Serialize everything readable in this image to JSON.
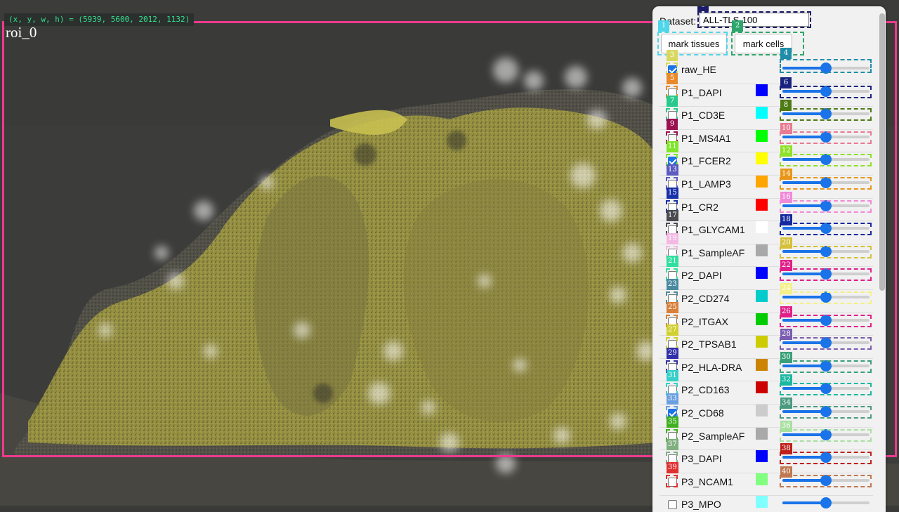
{
  "viewer": {
    "coord_readout": "(x, y, w, h) = (5939, 5600, 2012, 1132)",
    "roi_label": "roi_0",
    "roi_color": "#ee3a8f"
  },
  "panel": {
    "dataset_label": "Dataset:",
    "dataset_value": "ALL-TLS-100",
    "mark_tissues_label": "mark tissues",
    "mark_cells_label": "mark cells"
  },
  "tags": [
    {
      "n": "0",
      "color": "#1c1c6b"
    },
    {
      "n": "1",
      "color": "#4fd6e8"
    },
    {
      "n": "2",
      "color": "#2da66b"
    },
    {
      "n": "3",
      "color": "#d8d860"
    },
    {
      "n": "4",
      "color": "#1f8da8"
    },
    {
      "n": "5",
      "color": "#e88a2a"
    },
    {
      "n": "6",
      "color": "#1a237e"
    },
    {
      "n": "7",
      "color": "#28c98c"
    },
    {
      "n": "8",
      "color": "#4e7a16"
    },
    {
      "n": "9",
      "color": "#9c1150"
    },
    {
      "n": "10",
      "color": "#e87a92"
    },
    {
      "n": "11",
      "color": "#7fe62a"
    },
    {
      "n": "12",
      "color": "#8ee028"
    },
    {
      "n": "13",
      "color": "#5a5cc0"
    },
    {
      "n": "14",
      "color": "#e8961a"
    },
    {
      "n": "15",
      "color": "#1830a8"
    },
    {
      "n": "16",
      "color": "#f08ad8"
    },
    {
      "n": "17",
      "color": "#4a4a50"
    },
    {
      "n": "18",
      "color": "#142a9e"
    },
    {
      "n": "19",
      "color": "#f3b9e3"
    },
    {
      "n": "20",
      "color": "#d4c03a"
    },
    {
      "n": "21",
      "color": "#2ee0a0"
    },
    {
      "n": "22",
      "color": "#e0208a"
    },
    {
      "n": "23",
      "color": "#4a8aa0"
    },
    {
      "n": "24",
      "color": "#f5f088"
    },
    {
      "n": "25",
      "color": "#d8803a"
    },
    {
      "n": "26",
      "color": "#e0208a"
    },
    {
      "n": "27",
      "color": "#d0d030"
    },
    {
      "n": "28",
      "color": "#7a5cb0"
    },
    {
      "n": "29",
      "color": "#3030a8"
    },
    {
      "n": "30",
      "color": "#3aa07a"
    },
    {
      "n": "31",
      "color": "#38d0c8"
    },
    {
      "n": "32",
      "color": "#1ab8a0"
    },
    {
      "n": "33",
      "color": "#6aa0e0"
    },
    {
      "n": "34",
      "color": "#4a9a80"
    },
    {
      "n": "35",
      "color": "#40b020"
    },
    {
      "n": "36",
      "color": "#a8e0a0"
    },
    {
      "n": "37",
      "color": "#80b080"
    },
    {
      "n": "38",
      "color": "#c0201a"
    },
    {
      "n": "39",
      "color": "#e03030"
    },
    {
      "n": "40",
      "color": "#c07850"
    }
  ],
  "channels": [
    {
      "name": "raw_HE",
      "checked": true,
      "color": "",
      "value": 0.5
    },
    {
      "name": "P1_DAPI",
      "checked": false,
      "color": "#0000ff",
      "value": 0.5
    },
    {
      "name": "P1_CD3E",
      "checked": false,
      "color": "#00ffff",
      "value": 0.5
    },
    {
      "name": "P1_MS4A1",
      "checked": false,
      "color": "#00ff00",
      "value": 0.5
    },
    {
      "name": "P1_FCER2",
      "checked": true,
      "color": "#ffff00",
      "value": 0.5
    },
    {
      "name": "P1_LAMP3",
      "checked": false,
      "color": "#ffa500",
      "value": 0.5
    },
    {
      "name": "P1_CR2",
      "checked": false,
      "color": "#ff0000",
      "value": 0.5
    },
    {
      "name": "P1_GLYCAM1",
      "checked": false,
      "color": "#ffffff",
      "value": 0.5
    },
    {
      "name": "P1_SampleAF",
      "checked": false,
      "color": "#a9a9a9",
      "value": 0.5
    },
    {
      "name": "P2_DAPI",
      "checked": false,
      "color": "#0000ff",
      "value": 0.5
    },
    {
      "name": "P2_CD274",
      "checked": false,
      "color": "#00cccc",
      "value": 0.5
    },
    {
      "name": "P2_ITGAX",
      "checked": false,
      "color": "#00cc00",
      "value": 0.5
    },
    {
      "name": "P2_TPSAB1",
      "checked": false,
      "color": "#cccc00",
      "value": 0.5
    },
    {
      "name": "P2_HLA-DRA",
      "checked": false,
      "color": "#cc8400",
      "value": 0.5
    },
    {
      "name": "P2_CD163",
      "checked": false,
      "color": "#cc0000",
      "value": 0.5
    },
    {
      "name": "P2_CD68",
      "checked": true,
      "color": "#cccccc",
      "value": 0.5
    },
    {
      "name": "P2_SampleAF",
      "checked": false,
      "color": "#a9a9a9",
      "value": 0.5
    },
    {
      "name": "P3_DAPI",
      "checked": false,
      "color": "#0000ff",
      "value": 0.5
    },
    {
      "name": "P3_NCAM1",
      "checked": false,
      "color": "#80ff80",
      "value": 0.5
    },
    {
      "name": "P3_MPO",
      "checked": false,
      "color": "#80ffff",
      "value": 0.5
    }
  ]
}
